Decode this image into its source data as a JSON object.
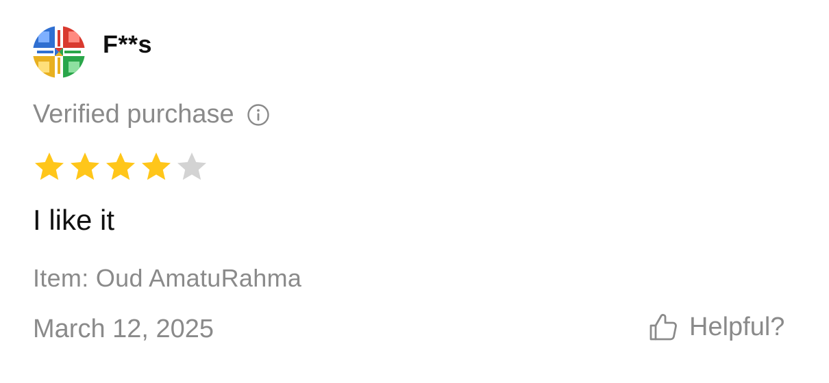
{
  "review": {
    "username": "F**s",
    "avatar_icon": "ludo-board-avatar",
    "verified_label": "Verified purchase",
    "info_icon": "info-icon",
    "rating": 4,
    "max_rating": 5,
    "comment": "I like it",
    "item_label": "Item: Oud AmatuRahma",
    "date": "March 12, 2025",
    "helpful_label": "Helpful?",
    "helpful_icon": "thumbs-up-icon"
  },
  "colors": {
    "star_filled": "#FFC61A",
    "star_empty": "#D3D3D3",
    "secondary_text": "#8A8A8A",
    "primary_text": "#111111"
  }
}
